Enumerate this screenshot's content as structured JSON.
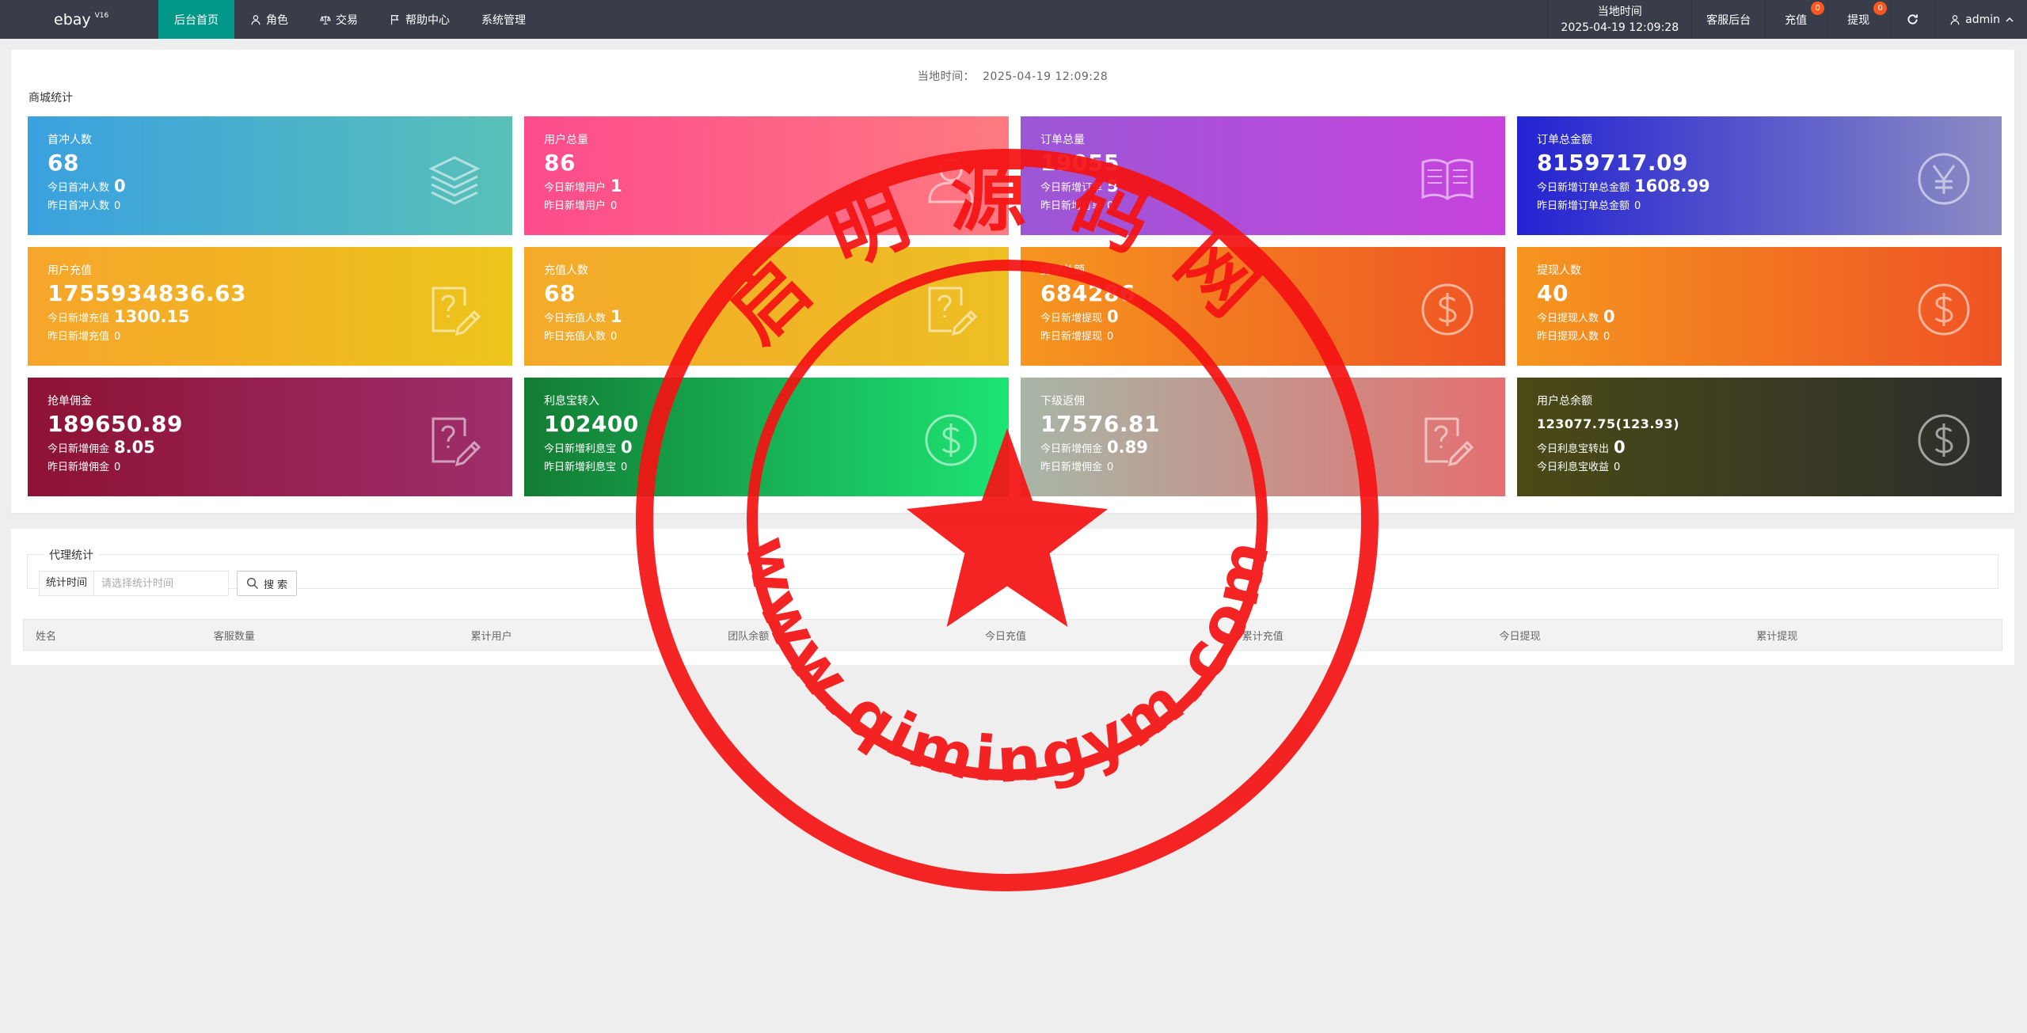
{
  "brand": {
    "name": "ebay",
    "version": "V16"
  },
  "nav": [
    {
      "label": "后台首页",
      "icon": "home",
      "active": true
    },
    {
      "label": "角色",
      "icon": "user-icon"
    },
    {
      "label": "交易",
      "icon": "scale-icon"
    },
    {
      "label": "帮助中心",
      "icon": "flag-icon"
    },
    {
      "label": "系统管理",
      "icon": ""
    }
  ],
  "header_right": {
    "time_label": "当地时间",
    "time_value": "2025-04-19 12:09:28",
    "service": "客服后台",
    "recharge": {
      "label": "充值",
      "badge": "0"
    },
    "withdraw": {
      "label": "提现",
      "badge": "0"
    },
    "refresh_icon": "refresh-icon",
    "user": "admin"
  },
  "main": {
    "local_time_label": "当地时间：",
    "local_time_value": "2025-04-19 12:09:28",
    "section_title": "商城统计"
  },
  "cards": [
    {
      "title": "首冲人数",
      "value": "68",
      "today_label": "今日首冲人数",
      "today_value": "0",
      "yesterday_label": "昨日首冲人数",
      "yesterday_value": "0",
      "icon": "layers-icon",
      "colors": [
        "#3aa1e0",
        "#59c0b8"
      ]
    },
    {
      "title": "用户总量",
      "value": "86",
      "today_label": "今日新增用户",
      "today_value": "1",
      "yesterday_label": "昨日新增用户",
      "yesterday_value": "0",
      "icon": "users-icon",
      "colors": [
        "#fd4b8c",
        "#fe7a80"
      ]
    },
    {
      "title": "订单总量",
      "value": "19055",
      "today_label": "今日新增订单",
      "today_value": "5",
      "yesterday_label": "昨日新增订单",
      "yesterday_value": "0",
      "icon": "book-icon",
      "colors": [
        "#9b57d5",
        "#c743dd"
      ]
    },
    {
      "title": "订单总金额",
      "value": "8159717.09",
      "today_label": "今日新增订单总金额",
      "today_value": "1608.99",
      "yesterday_label": "昨日新增订单总金额",
      "yesterday_value": "0",
      "icon": "yen-icon",
      "colors": [
        "#2323d2",
        "#8c8cc4"
      ]
    },
    {
      "title": "用户充值",
      "value": "1755934836.63",
      "today_label": "今日新增充值",
      "today_value": "1300.15",
      "yesterday_label": "昨日新增充值",
      "yesterday_value": "0",
      "icon": "edit-doc-icon",
      "colors": [
        "#f6a52a",
        "#ecc51b"
      ]
    },
    {
      "title": "充值人数",
      "value": "68",
      "today_label": "今日充值人数",
      "today_value": "1",
      "yesterday_label": "昨日充值人数",
      "yesterday_value": "0",
      "icon": "edit-doc-icon",
      "colors": [
        "#f4a92a",
        "#edbf23"
      ]
    },
    {
      "title": "提现总额",
      "value": "684286",
      "today_label": "今日新增提现",
      "today_value": "0",
      "yesterday_label": "昨日新增提现",
      "yesterday_value": "0",
      "icon": "dollar-icon",
      "colors": [
        "#f5961f",
        "#ef5324"
      ]
    },
    {
      "title": "提现人数",
      "value": "40",
      "today_label": "今日提现人数",
      "today_value": "0",
      "yesterday_label": "昨日提现人数",
      "yesterday_value": "0",
      "icon": "dollar-icon",
      "colors": [
        "#f5961f",
        "#ef5324"
      ]
    },
    {
      "title": "抢单佣金",
      "value": "189650.89",
      "today_label": "今日新增佣金",
      "today_value": "8.05",
      "yesterday_label": "昨日新增佣金",
      "yesterday_value": "0",
      "icon": "edit-doc-icon",
      "colors": [
        "#8d1233",
        "#9e2f6d"
      ]
    },
    {
      "title": "利息宝转入",
      "value": "102400",
      "today_label": "今日新增利息宝",
      "today_value": "0",
      "yesterday_label": "昨日新增利息宝",
      "yesterday_value": "0",
      "icon": "dollar-icon",
      "colors": [
        "#137c33",
        "#1de474"
      ]
    },
    {
      "title": "下级返佣",
      "value": "17576.81",
      "today_label": "今日新增佣金",
      "today_value": "0.89",
      "yesterday_label": "昨日新增佣金",
      "yesterday_value": "0",
      "icon": "edit-doc-icon",
      "colors": [
        "#a7b6a7",
        "#e47070"
      ]
    },
    {
      "title": "用户总余额",
      "value": "123077.75(123.93)",
      "today_label": "今日利息宝转出",
      "today_value": "0",
      "yesterday_label": "今日利息宝收益",
      "yesterday_value": "0",
      "icon": "dollar-icon",
      "colors": [
        "#4a4a16",
        "#2d2d2d"
      ],
      "small_value": true
    }
  ],
  "agent": {
    "legend": "代理统计",
    "filter_label": "统计时间",
    "filter_placeholder": "请选择统计时间",
    "search_label": "搜 索",
    "columns": [
      "姓名",
      "客服数量",
      "累计用户",
      "团队余额",
      "今日充值",
      "累计充值",
      "今日提现",
      "累计提现"
    ]
  },
  "watermark": {
    "top_text": "启明源码网",
    "bottom_text": "www.qimingym.com"
  }
}
